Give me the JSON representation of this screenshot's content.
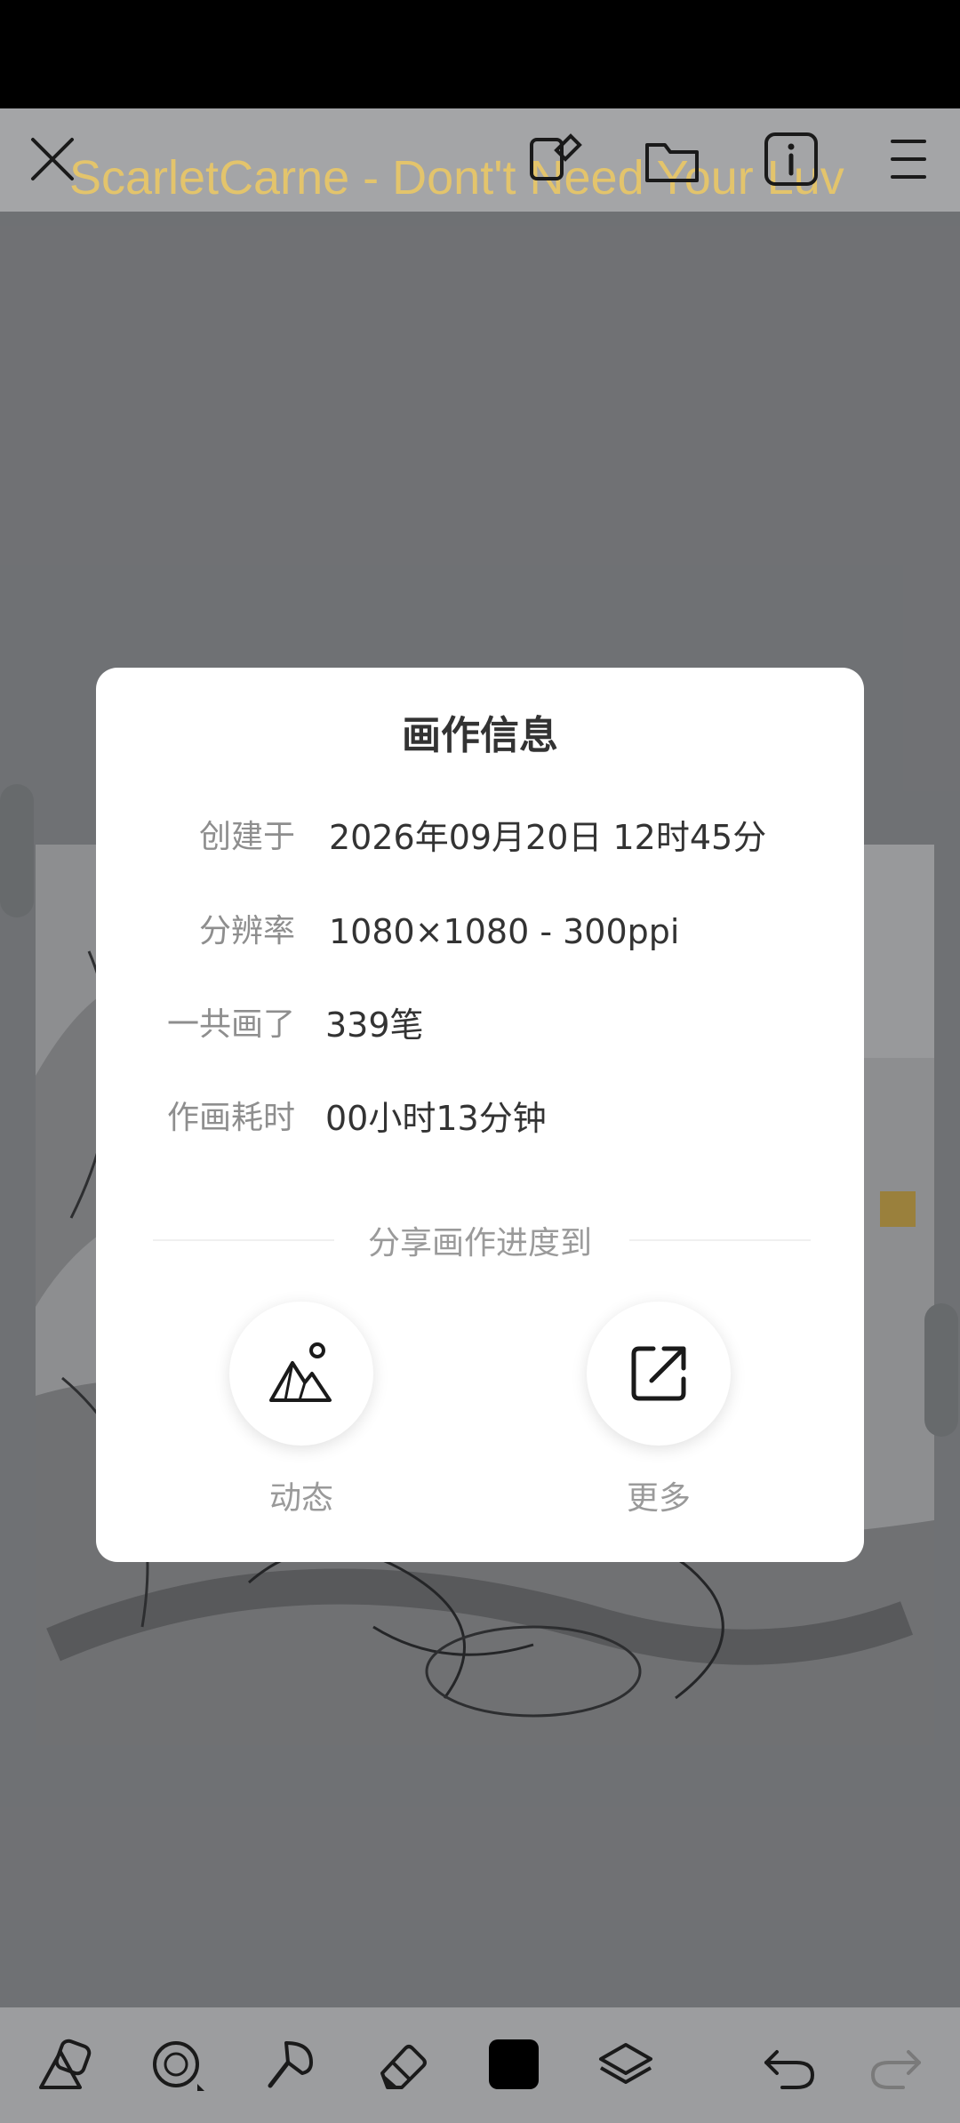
{
  "app": {
    "song_title": "ScarletCarne - Dont't Need Your Luv"
  },
  "topbar": {
    "icons": [
      "close-icon",
      "shapes-edit-icon",
      "folder-icon",
      "info-icon",
      "menu-icon"
    ]
  },
  "dialog": {
    "title": "画作信息",
    "rows": [
      {
        "label": "创建于",
        "value": "2026年09月20日 12时45分"
      },
      {
        "label": "分辨率",
        "value": "1080×1080 - 300ppi"
      },
      {
        "label": "一共画了",
        "value": "339笔"
      },
      {
        "label": "作画耗时",
        "value": "00小时13分钟"
      }
    ],
    "share_label": "分享画作进度到",
    "share_options": [
      {
        "label": "动态",
        "icon": "mountain-photo-icon"
      },
      {
        "label": "更多",
        "icon": "external-share-icon"
      }
    ]
  },
  "toolbar": {
    "tools": [
      "shape-tool-icon",
      "brush-library-icon",
      "brush-icon",
      "eraser-icon",
      "color-swatch-icon",
      "layers-icon",
      "undo-icon",
      "redo-icon"
    ],
    "current_color": "#000000"
  },
  "colors": {
    "title_accent": "#e3c46c",
    "status_bar": "#000000",
    "dialog_bg": "#ffffff"
  }
}
